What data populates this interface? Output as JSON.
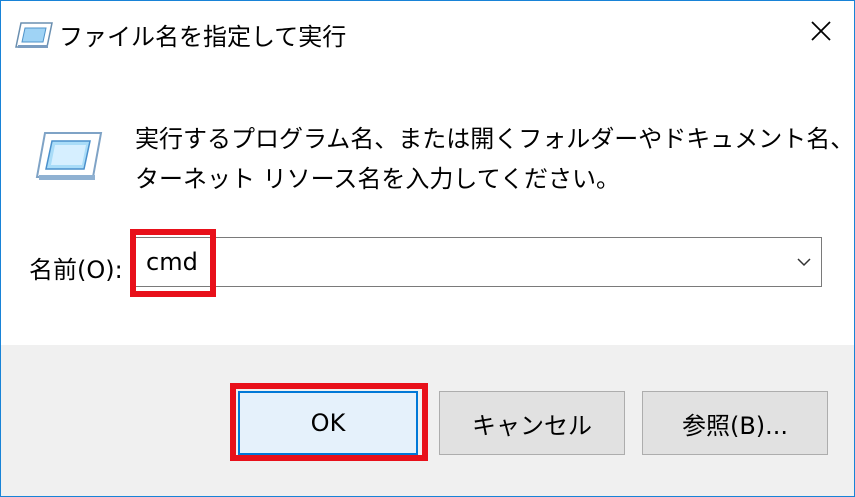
{
  "window": {
    "title": "ファイル名を指定して実行",
    "title_icon": "run-dialog-icon",
    "close_icon": "close-icon"
  },
  "content": {
    "icon": "run-dialog-icon",
    "description_line1": "実行するプログラム名、または開くフォルダーやドキュメント名、イン",
    "description_line2": "ターネット リソース名を入力してください。"
  },
  "name_field": {
    "label": "名前(O):",
    "value": "cmd",
    "dropdown_icon": "chevron-down-icon"
  },
  "buttons": {
    "ok": "OK",
    "cancel": "キャンセル",
    "browse": "参照(B)..."
  },
  "colors": {
    "highlight": "#e8101a",
    "accent": "#0078d7",
    "footer_bg": "#f0f0f0"
  }
}
